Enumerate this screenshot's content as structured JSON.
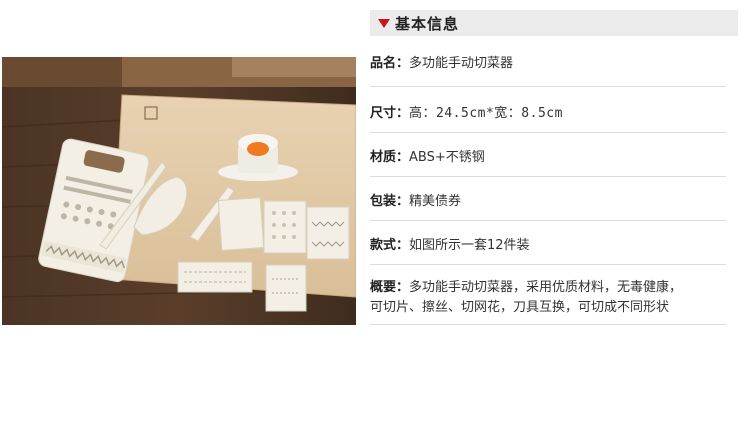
{
  "header": {
    "title": "基本信息"
  },
  "info": {
    "name": {
      "label": "品名：",
      "value": "多功能手动切菜器"
    },
    "size": {
      "label": "尺寸：",
      "value": "高：24.5cm*宽：8.5cm"
    },
    "material": {
      "label": "材质：",
      "value": "ABS+不锈钢"
    },
    "package": {
      "label": "包装：",
      "value": "精美债券"
    },
    "style": {
      "label": "款式：",
      "value": "如图所示一套12件装"
    },
    "summary": {
      "label": "概要：",
      "line1": "多功能手动切菜器，采用优质材料，无毒健康，",
      "line2": "可切片、擦丝、切网花，刀具互换，可切成不同形状"
    }
  },
  "colors": {
    "accent_arrow": "#c8161d",
    "header_bg": "#ebebeb",
    "divider": "#dcdcdc"
  },
  "photo": {
    "subject": "vegetable-slicer-set-photo"
  }
}
